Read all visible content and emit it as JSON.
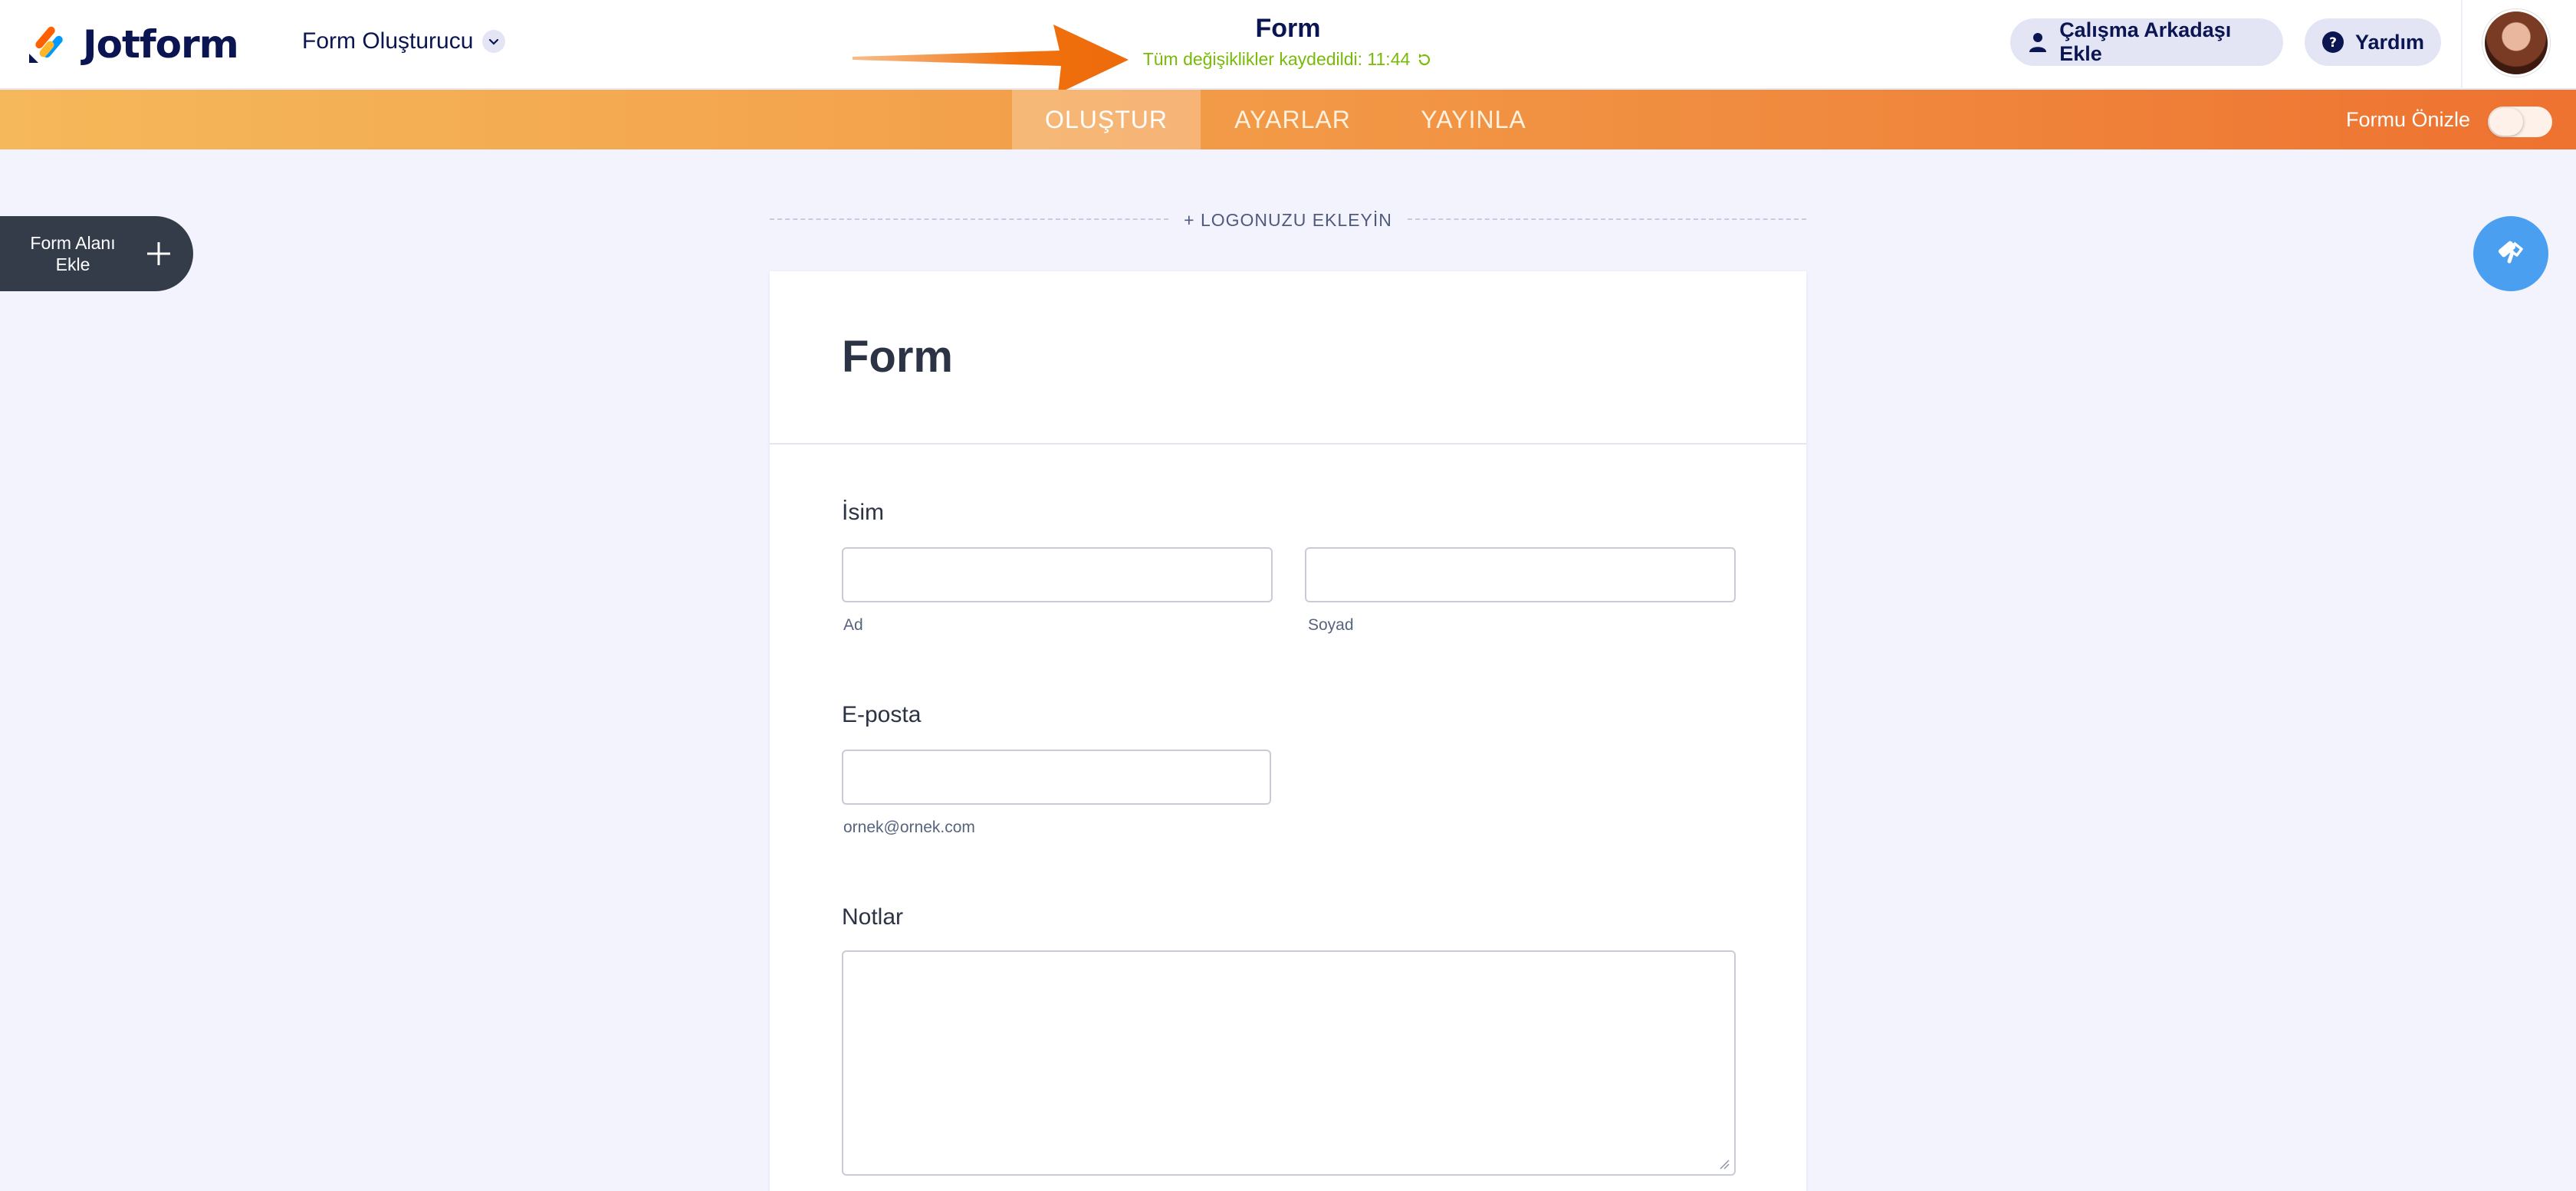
{
  "header": {
    "brand": "Jotform",
    "product_switcher": "Form Oluşturucu",
    "form_title": "Form",
    "save_status": "Tüm değişiklikler kaydedildi: 11:44",
    "invite_label": "Çalışma Arkadaşı Ekle",
    "help_label": "Yardım"
  },
  "nav": {
    "tabs": [
      {
        "label": "OLUŞTUR",
        "active": true
      },
      {
        "label": "AYARLAR",
        "active": false
      },
      {
        "label": "YAYINLA",
        "active": false
      }
    ],
    "preview_label": "Formu Önizle",
    "preview_enabled": false
  },
  "sidebar": {
    "add_field_line1": "Form Alanı",
    "add_field_line2": "Ekle"
  },
  "canvas": {
    "add_logo": "+ LOGONUZU EKLEYİN"
  },
  "form": {
    "title": "Form",
    "fields": {
      "name_label": "İsim",
      "first_sublabel": "Ad",
      "last_sublabel": "Soyad",
      "email_label": "E-posta",
      "email_sublabel": "ornek@ornek.com",
      "notes_label": "Notlar"
    }
  },
  "colors": {
    "accent_orange": "#f08a3e",
    "saved_green": "#78bb07",
    "designer_blue": "#4a9ff0",
    "navy": "#0a1551"
  }
}
